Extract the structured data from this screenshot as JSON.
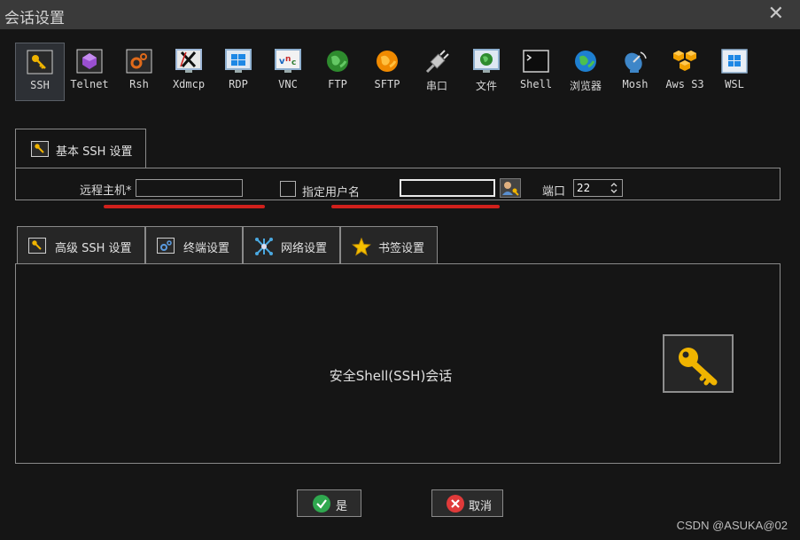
{
  "window": {
    "title": "会话设置"
  },
  "protocols": [
    {
      "label": "SSH",
      "icon": "ssh-key-icon",
      "selected": true
    },
    {
      "label": "Telnet",
      "icon": "telnet-icon"
    },
    {
      "label": "Rsh",
      "icon": "rsh-icon"
    },
    {
      "label": "Xdmcp",
      "icon": "xdmcp-icon"
    },
    {
      "label": "RDP",
      "icon": "rdp-icon"
    },
    {
      "label": "VNC",
      "icon": "vnc-icon"
    },
    {
      "label": "FTP",
      "icon": "ftp-globe-icon"
    },
    {
      "label": "SFTP",
      "icon": "sftp-globe-icon"
    },
    {
      "label": "串口",
      "icon": "serial-plug-icon"
    },
    {
      "label": "文件",
      "icon": "file-monitor-icon"
    },
    {
      "label": "Shell",
      "icon": "shell-terminal-icon"
    },
    {
      "label": "浏览器",
      "icon": "browser-globe-icon"
    },
    {
      "label": "Mosh",
      "icon": "mosh-satellite-icon"
    },
    {
      "label": "Aws S3",
      "icon": "aws-s3-icon"
    },
    {
      "label": "WSL",
      "icon": "wsl-windows-icon"
    }
  ],
  "basic_tab": {
    "label": "基本 SSH 设置"
  },
  "basic": {
    "remote_host_label": "远程主机*",
    "remote_host_value": "",
    "specify_user_label": "指定用户名",
    "username_value": "",
    "port_label": "端口",
    "port_value": "22"
  },
  "tabs": [
    {
      "label": "高级 SSH 设置",
      "icon": "wrench-key-icon"
    },
    {
      "label": "终端设置",
      "icon": "gears-icon"
    },
    {
      "label": "网络设置",
      "icon": "network-star-icon"
    },
    {
      "label": "书签设置",
      "icon": "star-icon"
    }
  ],
  "main": {
    "description": "安全Shell(SSH)会话"
  },
  "buttons": {
    "ok": "是",
    "cancel": "取消"
  },
  "watermark": "CSDN @ASUKA@02",
  "colors": {
    "accent_red": "#d0201c",
    "ok_green": "#2fa84f",
    "cancel_red": "#e03a3a",
    "key_yellow": "#f0b400"
  }
}
